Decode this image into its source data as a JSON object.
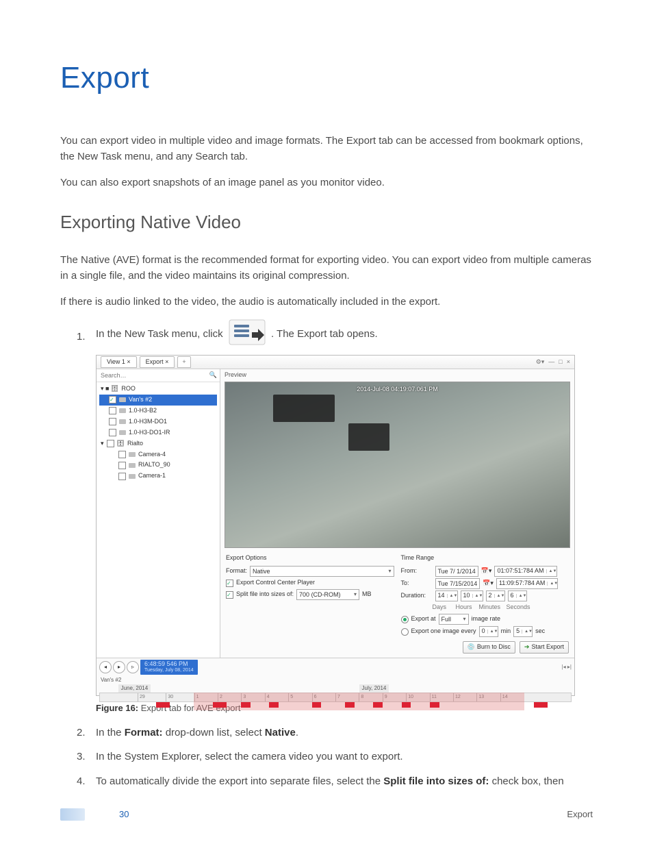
{
  "title": "Export",
  "intro": {
    "p1": "You can export video in multiple video and image formats. The Export tab can be accessed from bookmark options, the New Task menu, and any Search tab.",
    "p2": "You can also export snapshots of an image panel as you monitor video."
  },
  "section1": {
    "heading": "Exporting Native Video",
    "p1": "The Native (AVE) format is the recommended format for exporting video. You can export video from multiple cameras in a single file, and the video maintains its original compression.",
    "p2": "If there is audio linked to the video, the audio is automatically included in the export."
  },
  "steps": {
    "s1a": "In the New Task menu, click ",
    "s1b": ". The Export tab opens.",
    "s2a": "In the ",
    "s2b_bold": "Format:",
    "s2c": " drop-down list, select ",
    "s2d_bold": "Native",
    "s2e": ".",
    "s3": "In the System Explorer, select the camera video you want to export.",
    "s4a": "To automatically divide the export into separate files, select the ",
    "s4b_bold": "Split file into sizes of:",
    "s4c": " check box, then"
  },
  "figure": {
    "caption_label": "Figure 16:",
    "caption_text": " Export tab for AVE export"
  },
  "screenshot": {
    "tabs": {
      "view": "View 1  ×",
      "export": "Export ×",
      "add": "+"
    },
    "winicons": {
      "gear": "⚙▾",
      "min": "—",
      "max": "□",
      "close": "×"
    },
    "search_placeholder": "Search…",
    "tree": {
      "root": "ROO",
      "selected": "Van's #2",
      "n2": "1.0-H3-B2",
      "n3": "1.0-H3M-DO1",
      "n4": "1.0-H3-DO1-IR",
      "rialto": "Rialto",
      "cam4": "Camera-4",
      "rialto90": "RIALTO_90",
      "cam1": "Camera-1"
    },
    "preview_label": "Preview",
    "timestamp": "2014-Jul-08 04:19:07.061 PM",
    "export_options": {
      "title": "Export Options",
      "format_label": "Format:",
      "format_value": "Native",
      "player_label": "Export Control Center Player",
      "split_label": "Split file into sizes of:",
      "split_value": "700 (CD-ROM)",
      "split_unit": "MB"
    },
    "time_range": {
      "title": "Time Range",
      "from_label": "From:",
      "from_date": "Tue   7/ 1/2014",
      "from_time": "01:07:51:784  AM",
      "to_label": "To:",
      "to_date": "Tue   7/15/2014",
      "to_time": "11:09:57:784  AM",
      "duration_label": "Duration:",
      "d_days": "14",
      "d_hours": "10",
      "d_min": "2",
      "d_sec": "6",
      "u_days": "Days",
      "u_hours": "Hours",
      "u_min": "Minutes",
      "u_sec": "Seconds",
      "export_at_a": "Export at",
      "export_at_value": "Full",
      "export_at_b": "image rate",
      "export_one_a": "Export one image every",
      "export_one_v1": "0",
      "export_one_u1": "min",
      "export_one_v2": "5",
      "export_one_u2": "sec"
    },
    "buttons": {
      "burn": "Burn to Disc",
      "start": "Start Export"
    },
    "timeline": {
      "clock_time": "6:48:59 546 PM",
      "clock_date": "Tuesday, July 08, 2014",
      "month1": "June, 2014",
      "month2": "July, 2014",
      "cam_label": "Van's #2"
    }
  },
  "footer": {
    "page": "30",
    "section": "Export"
  },
  "chart_data": {
    "type": "table",
    "title": "Export tab — Time Range fields",
    "rows": [
      {
        "field": "From",
        "date": "Tue 7/1/2014",
        "time": "01:07:51:784 AM"
      },
      {
        "field": "To",
        "date": "Tue 7/15/2014",
        "time": "11:09:57:784 AM"
      },
      {
        "field": "Duration",
        "days": 14,
        "hours": 10,
        "minutes": 2,
        "seconds": 6
      },
      {
        "field": "Split file size",
        "value": 700,
        "unit": "MB (CD-ROM)"
      }
    ]
  }
}
